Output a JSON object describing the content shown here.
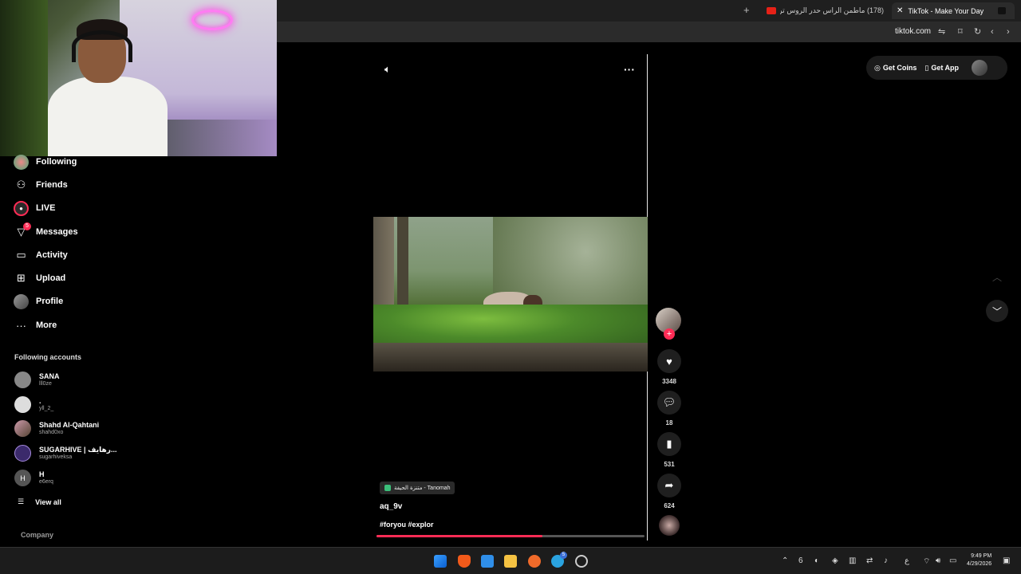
{
  "browser": {
    "tabs": [
      {
        "title": "(178) ماطمن الراس حدر الروس ترعل ..."
      },
      {
        "title": "TikTok - Make Your Day"
      }
    ],
    "url": "tiktok.com"
  },
  "sidebar": {
    "items": [
      {
        "label": "Following",
        "icon": "following-icon"
      },
      {
        "label": "Friends",
        "icon": "friends-icon"
      },
      {
        "label": "LIVE",
        "icon": "live-icon"
      },
      {
        "label": "Messages",
        "icon": "messages-icon",
        "badge": "5"
      },
      {
        "label": "Activity",
        "icon": "activity-icon"
      },
      {
        "label": "Upload",
        "icon": "upload-icon"
      },
      {
        "label": "Profile",
        "icon": "profile-icon"
      },
      {
        "label": "More",
        "icon": "more-icon"
      }
    ],
    "following_title": "Following accounts",
    "accounts": [
      {
        "name": "SANA",
        "handle": "lll0ze"
      },
      {
        "name": ".",
        "handle": "yll_2_"
      },
      {
        "name": "Shahd Al-Qahtani",
        "handle": "shahd0xo"
      },
      {
        "name": "SUGARHIVE | رهايف...",
        "handle": "sugarhiveksa"
      },
      {
        "name": "H",
        "handle": "e6erq",
        "initial": "H"
      }
    ],
    "view_all": "View all",
    "company": "Company"
  },
  "video": {
    "sound": "متنزة الحيفة - Tanomah",
    "author": "aq_9v",
    "tags": "#foryou #explor",
    "progress": 0.62
  },
  "actions": {
    "likes": "3348",
    "comments": "18",
    "saves": "531",
    "shares": "624"
  },
  "header": {
    "get_coins": "Get Coins",
    "get_app": "Get App"
  },
  "taskbar": {
    "time": "9:49 PM",
    "date": "4/29/2026",
    "lang": "ع",
    "num": "6",
    "telegram_badge": "5"
  },
  "colors": {
    "accent": "#fe2c55",
    "background": "#000000"
  }
}
